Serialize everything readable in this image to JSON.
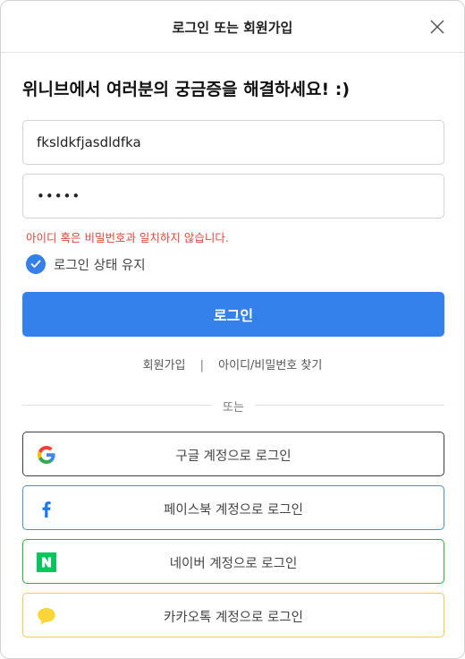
{
  "header": {
    "title": "로그인  또는 회원가입"
  },
  "headline": "위니브에서 여러분의 궁금증을 해결하세요! :)",
  "form": {
    "id_value": "fksldkfjasdldfka",
    "password_value": "•••••",
    "error": "아이디 혹은 비밀번호과 일치하지 않습니다.",
    "keep_login_label": "로그인 상태 유지",
    "keep_login_checked": true,
    "login_button": "로그인"
  },
  "links": {
    "signup": "회원가입",
    "separator": "|",
    "find": "아이디/비밀번호 찾기"
  },
  "divider": "또는",
  "social": {
    "google": "구글 계정으로 로그인",
    "facebook": "페이스북 계정으로 로그인",
    "naver": "네이버 계정으로 로그인",
    "kakao": "카카오톡 계정으로 로그인"
  },
  "colors": {
    "primary": "#3581ec",
    "error": "#e0463b",
    "naver": "#03c75a",
    "kakao": "#f9d535",
    "facebook": "#1877f2"
  }
}
